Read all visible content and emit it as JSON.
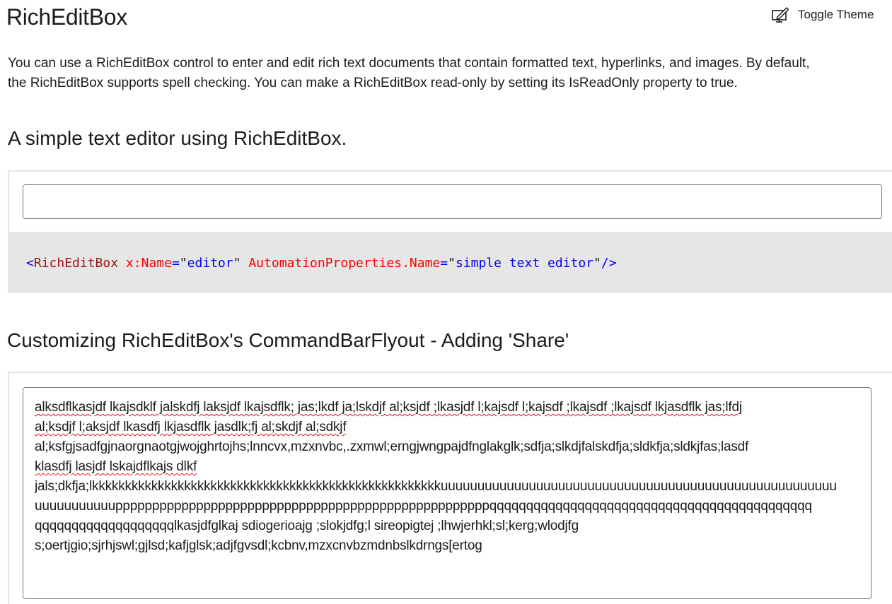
{
  "page": {
    "title": "RichEditBox",
    "toggle_theme_label": "Toggle Theme",
    "toggle_theme_icon": "toggle-theme-icon",
    "description_line1": "You can use a RichEditBox control to enter and edit rich text documents that contain formatted text, hyperlinks, and images. By default,",
    "description_line2": "the RichEditBox supports spell checking. You can make a RichEditBox read-only by setting its IsReadOnly property to true."
  },
  "example1": {
    "header": "A simple text editor using RichEditBox.",
    "editor_value": "",
    "code": {
      "open": "<",
      "tag": "RichEditBox",
      "attr1": "x:Name",
      "eq1": "=",
      "q1a": "\"",
      "val1": "editor",
      "q1b": "\"",
      "attr2": "AutomationProperties.Name",
      "eq2": "=",
      "q2a": "\"",
      "val2": "simple text editor",
      "q2b": "\"",
      "close": "/>"
    }
  },
  "example2": {
    "header": "Customizing RichEditBox's CommandBarFlyout - Adding 'Share'",
    "lines": [
      "alksdflkasjdf lkajsdklf jalskdfj laksjdf lkajsdflk; jas;lkdf ja;lskdjf al;ksjdf ;lkasjdf l;kajsdf l;kajsdf ;lkajsdf ;lkajsdf lkjasdflk jas;lfdj",
      "al;ksdjf l;aksjdf lkasdfj lkjasdflk jasdlk;fj al;skdjf al;sdkjf",
      "al;ksfgjsadfgjnaorgnaotgjwojghrtojhs;lnncvx,mzxnvbc,.zxmwl;erngjwngpajdfnglakglk;sdfja;slkdjfalskdfja;sldkfja;sldkjfas;lasdf",
      "klasdfj lasjdf lskajdflkajs dlkf",
      "jals;dkfja;lkkkkkkkkkkkkkkkkkkkkkkkkkkkkkkkkkkkkkkkkkkkkkkkkkkkkkuuuuuuuuuuuuuuuuuuuuuuuuuuuuuuuuuuuuuuuuuuuuuuuuuuuuuu",
      "uuuuuuuuuuupppppppppppppppppppppppppppppppppppppppppppppppppppqqqqqqqqqqqqqqqqqqqqqqqqqqqqqqqqqqqqqqqqqqqq",
      "qqqqqqqqqqqqqqqqqqqlkasjdfglkaj sdiogerioajg ;slokjdfg;l sireopigtej ;lhwjerhkl;sl;kerg;wlodjfg",
      "s;oertjgio;sjrhjswl;gjlsd;kafjglsk;adjfgvsdl;kcbnv,mzxcnvbzmdnbslkdrngs[ertog"
    ],
    "accent_misspelled": "#e81123"
  },
  "colors": {
    "code_background": "#e6e6e6",
    "xaml_tag": "#a31515",
    "xaml_attribute": "#ff0000",
    "xaml_value": "#0000ff"
  }
}
